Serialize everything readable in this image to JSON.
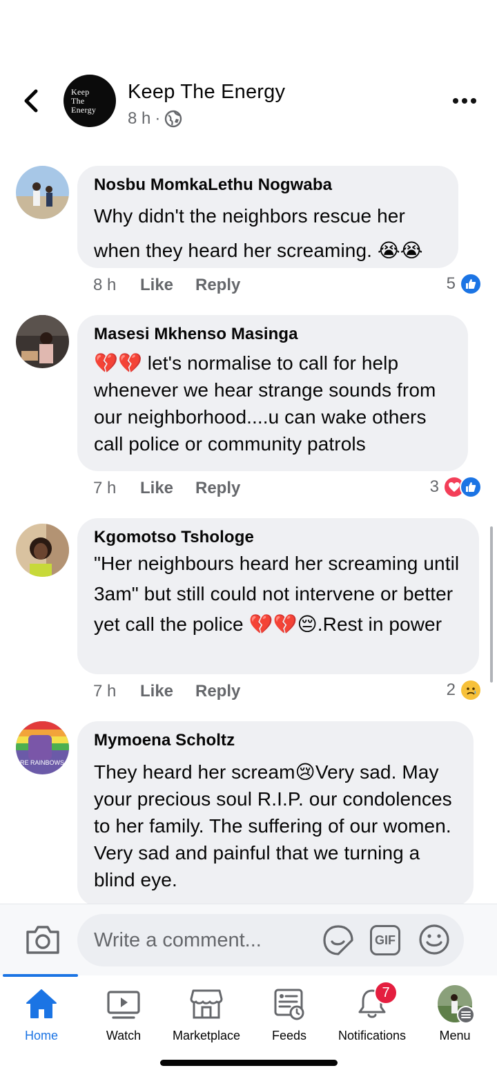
{
  "header": {
    "page_name": "Keep The Energy",
    "post_time": "8 h",
    "separator": "·",
    "logo_lines": [
      "Keep",
      "The",
      "Energy"
    ],
    "privacy_icon": "globe-icon"
  },
  "comments": [
    {
      "author": "Nosbu MomkaLethu Nogwaba",
      "text": "Why didn't the neighbors rescue her when they heard her screaming. 😭😭",
      "time": "8 h",
      "like_label": "Like",
      "reply_label": "Reply",
      "reaction_count": "5",
      "reactions": [
        "like"
      ]
    },
    {
      "author": "Masesi Mkhenso Masinga",
      "text": "💔💔 let's normalise to call for help whenever we hear strange sounds from our neighborhood....u can wake others call police or community patrols",
      "time": "7 h",
      "like_label": "Like",
      "reply_label": "Reply",
      "reaction_count": "3",
      "reactions": [
        "love",
        "like"
      ]
    },
    {
      "author": "Kgomotso Tshologe",
      "text": "\"Her neighbours heard her screaming until 3am\" but still could not intervene or better yet call the police 💔💔😔.Rest in power",
      "time": "7 h",
      "like_label": "Like",
      "reply_label": "Reply",
      "reaction_count": "2",
      "reactions": [
        "sad"
      ]
    },
    {
      "author": "Mymoena Scholtz",
      "text": "They heard her scream😢Very sad. May your precious soul R.I.P. our condolences to her family. The suffering of our women. Very sad and painful that we turning a blind eye.",
      "avatar_text": "RE RAINBOWS"
    }
  ],
  "composer": {
    "placeholder": "Write a comment...",
    "gif_label": "GIF"
  },
  "tabs": [
    {
      "label": "Home",
      "icon": "home-icon",
      "active": true
    },
    {
      "label": "Watch",
      "icon": "watch-icon",
      "active": false
    },
    {
      "label": "Marketplace",
      "icon": "marketplace-icon",
      "active": false
    },
    {
      "label": "Feeds",
      "icon": "feeds-icon",
      "active": false
    },
    {
      "label": "Notifications",
      "icon": "bell-icon",
      "active": false,
      "badge": "7"
    },
    {
      "label": "Menu",
      "icon": "menu-avatar",
      "active": false
    }
  ],
  "colors": {
    "accent": "#1b74e4",
    "bubble": "#eff0f3",
    "secondary_text": "#65676b",
    "badge": "#e41e3f"
  }
}
